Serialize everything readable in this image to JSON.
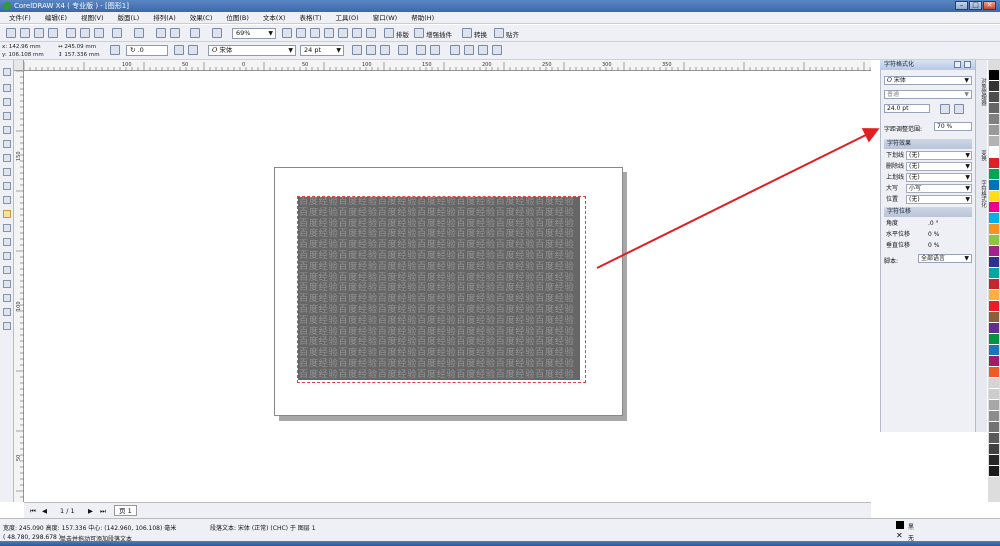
{
  "window": {
    "title": "CorelDRAW X4 ( 专业版 ) - [图形1]",
    "min": "–",
    "max": "□",
    "close": "✕"
  },
  "menu": [
    "文件(F)",
    "编辑(E)",
    "视图(V)",
    "版面(L)",
    "排列(A)",
    "效果(C)",
    "位图(B)",
    "文本(X)",
    "表格(T)",
    "工具(O)",
    "窗口(W)",
    "帮助(H)"
  ],
  "toolbar1": {
    "zoom": "69%",
    "buttons": [
      "排版",
      "增强插件",
      "转换",
      "贴齐"
    ]
  },
  "toolbar2": {
    "x": "142.96 mm",
    "y": "106.108 mm",
    "w": "245.09 mm",
    "h": "157.336 mm",
    "rotation": ".0",
    "font": "宋体",
    "font_size": "24 pt"
  },
  "ruler": {
    "ticks": [
      "100",
      "50",
      "0",
      "50",
      "100",
      "150",
      "200",
      "250",
      "300",
      "350"
    ],
    "vticks": [
      "150",
      "100",
      "50"
    ]
  },
  "document": {
    "text_char_sequence": "验百度经",
    "text_prefix": "百度经"
  },
  "docker": {
    "title": "字符格式化",
    "font": "宋体",
    "style": "普通",
    "size": "24.0 pt",
    "kerning_label": "字距调整范围:",
    "kerning_value": "70 %",
    "effects_title": "字符效果",
    "effects": [
      {
        "label": "下划线",
        "value": "(无)"
      },
      {
        "label": "删除线",
        "value": "(无)"
      },
      {
        "label": "上划线",
        "value": "(无)"
      },
      {
        "label": "大写",
        "value": "小写"
      },
      {
        "label": "位置",
        "value": "(无)"
      }
    ],
    "shift_title": "字符位移",
    "shifts": [
      {
        "label": "角度",
        "value": ".0 °"
      },
      {
        "label": "水平位移",
        "value": "0 %"
      },
      {
        "label": "垂直位移",
        "value": "0 %"
      }
    ],
    "script_label": "脚本:",
    "script_value": "全部语言"
  },
  "dock_tabs": [
    "对象管理器",
    "变换",
    "字符格式化"
  ],
  "page_nav": {
    "counter": "1 / 1",
    "tab": "页 1"
  },
  "status": {
    "line1_left": "宽度: 245.090 高度: 157.336 中心: (142.960, 106.108) 毫米",
    "line1_mid": "段落文本: 宋体 (正常) (CHC) 于 图层 1",
    "line2_left": "( 48.780, 298.678 )",
    "line2_mid": "单击并拖动可添加段落文本",
    "fill_label": "黑",
    "outline_label": "无"
  },
  "colors": {
    "text_fill": "#666666",
    "text_glyph": "#949494",
    "frame_border": "#e04040",
    "arrow": "#e02020",
    "palette": [
      "#000000",
      "#333333",
      "#4d4d4d",
      "#666666",
      "#808080",
      "#999999",
      "#b3b3b3",
      "#ffffff",
      "#e31e24",
      "#00a651",
      "#0072bc",
      "#ffde17",
      "#ec008c",
      "#00aeef",
      "#f7941d",
      "#8dc63f",
      "#a3238e",
      "#2e3192",
      "#00a99d",
      "#c1272d",
      "#fbb040",
      "#ed1c24",
      "#8b5e3c",
      "#662d91",
      "#009444",
      "#1b75bc",
      "#9e1f63",
      "#f15a24",
      "#d4d4d4",
      "#cccccc",
      "#a6a6a6",
      "#8c8c8c",
      "#737373",
      "#595959",
      "#404040",
      "#262626",
      "#1a1a1a"
    ]
  }
}
